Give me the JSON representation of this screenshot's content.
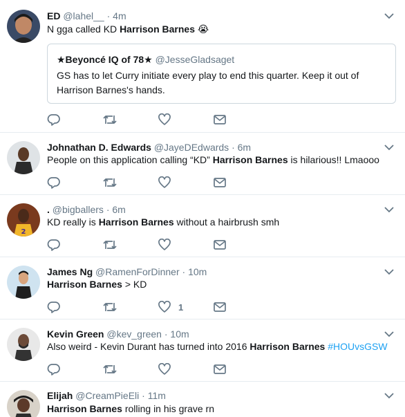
{
  "tweets": [
    {
      "name": "ED",
      "handle": "@lahel__",
      "sep": "·",
      "time": "4m",
      "text_pre": "N  gga called KD ",
      "text_bold": "Harrison Barnes",
      "text_post": " 😭",
      "quote": {
        "name": "★Beyoncé IQ of 78★",
        "handle": "@JesseGladsaget",
        "text": "GS has to let Curry initiate every play to end this quarter. Keep it out of Harrison Barnes's hands."
      }
    },
    {
      "name": "Johnathan D. Edwards",
      "handle": "@JayeDEdwards",
      "sep": "·",
      "time": "6m",
      "text_pre": "People on this application calling “KD” ",
      "text_bold": "Harrison Barnes",
      "text_post": " is hilarious!! Lmaooo"
    },
    {
      "name": ".",
      "handle": "@bigballers",
      "sep": "·",
      "time": "6m",
      "text_pre": "KD really is ",
      "text_bold": "Harrison Barnes",
      "text_post": " without a hairbrush smh"
    },
    {
      "name": "James Ng",
      "handle": "@RamenForDinner",
      "sep": "·",
      "time": "10m",
      "text_pre": "",
      "text_bold": "Harrison Barnes",
      "text_post": " > KD",
      "like_count": "1"
    },
    {
      "name": "Kevin Green",
      "handle": "@kev_green",
      "sep": "·",
      "time": "10m",
      "text_pre": "Also weird - Kevin Durant has turned into 2016 ",
      "text_bold": "Harrison Barnes",
      "text_post": " ",
      "hashtag": "#HOUvsGSW"
    },
    {
      "name": "Elijah",
      "handle": "@CreamPieEli",
      "sep": "·",
      "time": "11m",
      "text_pre": "",
      "text_bold": "Harrison Barnes",
      "text_post": " rolling in his grave rn"
    }
  ],
  "colors": {
    "name": "#14171a",
    "meta": "#657786",
    "icon": "#657786",
    "link": "#1da1f2",
    "divider": "#e6ecf0"
  },
  "icons": [
    "reply-icon",
    "retweet-icon",
    "like-icon",
    "dm-icon",
    "chevron-down-icon"
  ]
}
